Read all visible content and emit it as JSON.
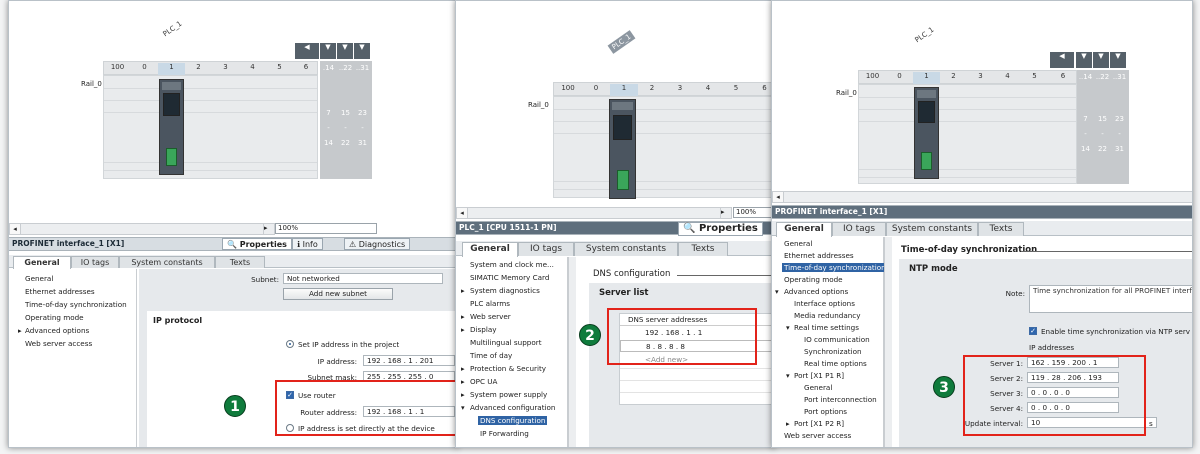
{
  "panel1": {
    "device_label": "PLC_1",
    "rail_label": "Rail_0",
    "slots": [
      "100",
      "0",
      "1",
      "2",
      "3",
      "4",
      "5",
      "6"
    ],
    "ext_cols": [
      ".14",
      "..22",
      "..31"
    ],
    "ext_nums": [
      [
        "7",
        "15",
        "23"
      ],
      [
        "-",
        "-",
        "-"
      ],
      [
        "14",
        "22",
        "31"
      ]
    ],
    "zoom": "100%",
    "title": "PROFINET interface_1 [X1]",
    "prop_tabs": [
      "Properties",
      "Info",
      "Diagnostics"
    ],
    "tabs": [
      "General",
      "IO tags",
      "System constants",
      "Texts"
    ],
    "nav": [
      "General",
      "Ethernet addresses",
      "Time-of-day synchronization",
      "Operating mode",
      "Advanced options",
      "Web server access"
    ],
    "subnet_label": "Subnet:",
    "subnet_value": "Not networked",
    "add_subnet": "Add new subnet",
    "section_title": "IP protocol",
    "radio_set_ip": "Set IP address in the project",
    "ip_label": "IP address:",
    "ip": [
      "192",
      ".",
      "168",
      ".",
      "1",
      ".",
      "201"
    ],
    "mask_label": "Subnet mask:",
    "mask": [
      "255",
      ".",
      "255",
      ".",
      "255",
      ".",
      "0"
    ],
    "use_router": "Use router",
    "router_label": "Router address:",
    "router": [
      "192",
      ".",
      "168",
      ".",
      "1",
      ".",
      "1"
    ],
    "radio_device": "IP address is set directly at the device",
    "badge": "1"
  },
  "panel2": {
    "device_label": "PLC_1",
    "rail_label": "Rail_0",
    "slots": [
      "100",
      "0",
      "1",
      "2",
      "3",
      "4",
      "5",
      "6"
    ],
    "zoom": "100%",
    "title": "PLC_1 [CPU 1511-1 PN]",
    "prop_tab": "Properties",
    "tabs": [
      "General",
      "IO tags",
      "System constants",
      "Texts"
    ],
    "nav": [
      "System and clock me...",
      "SIMATIC Memory Card",
      "System diagnostics",
      "PLC alarms",
      "Web server",
      "Display",
      "Multilingual support",
      "Time of day",
      "Protection & Security",
      "OPC UA",
      "System power supply",
      "Advanced configuration",
      "DNS configuration",
      "IP Forwarding"
    ],
    "section_title": "DNS configuration",
    "server_list": "Server list",
    "dns_header": "DNS server addresses",
    "dns_rows": [
      [
        "192",
        ".",
        "168",
        ".",
        "1",
        ".",
        "1"
      ],
      [
        "8",
        ".",
        "8",
        ".",
        "8",
        ".",
        "8"
      ]
    ],
    "add_new": "<Add new>",
    "badge": "2"
  },
  "panel3": {
    "device_label": "PLC_1",
    "rail_label": "Rail_0",
    "slots": [
      "100",
      "0",
      "1",
      "2",
      "3",
      "4",
      "5",
      "6"
    ],
    "ext_cols": [
      "..14",
      "..22",
      "..31"
    ],
    "ext_nums": [
      [
        "7",
        "15",
        "23"
      ],
      [
        "-",
        "-",
        "-"
      ],
      [
        "14",
        "22",
        "31"
      ]
    ],
    "title": "PROFINET interface_1 [X1]",
    "tabs": [
      "General",
      "IO tags",
      "System constants",
      "Texts"
    ],
    "nav": [
      "General",
      "Ethernet addresses",
      "Time-of-day synchronization",
      "Operating mode",
      "Advanced options",
      "Interface options",
      "Media redundancy",
      "Real time settings",
      "IO communication",
      "Synchronization",
      "Real time options",
      "Port [X1 P1 R]",
      "General",
      "Port interconnection",
      "Port options",
      "Port [X1 P2 R]",
      "Web server access"
    ],
    "section_title": "Time-of-day synchronization",
    "subsection": "NTP mode",
    "note_label": "Note:",
    "note_text": "Time synchronization for all PROFINET interfac",
    "enable_ntp": "Enable time synchronization via NTP serv",
    "ip_addresses": "IP addresses",
    "servers": [
      {
        "label": "Server 1:",
        "v": [
          "162",
          ".",
          "159",
          ".",
          "200",
          ".",
          "1"
        ]
      },
      {
        "label": "Server 2:",
        "v": [
          "119",
          ".",
          "28",
          ".",
          "206",
          ".",
          "193"
        ]
      },
      {
        "label": "Server 3:",
        "v": [
          "0",
          ".",
          "0",
          ".",
          "0",
          ".",
          "0"
        ]
      },
      {
        "label": "Server 4:",
        "v": [
          "0",
          ".",
          "0",
          ".",
          "0",
          ".",
          "0"
        ]
      }
    ],
    "interval_label": "Update interval:",
    "interval_value": "10",
    "interval_unit": "s",
    "badge": "3"
  },
  "colors": {
    "highlight": "#e2231a",
    "badge": "#0f7b3c",
    "selection": "#2f63a4"
  }
}
